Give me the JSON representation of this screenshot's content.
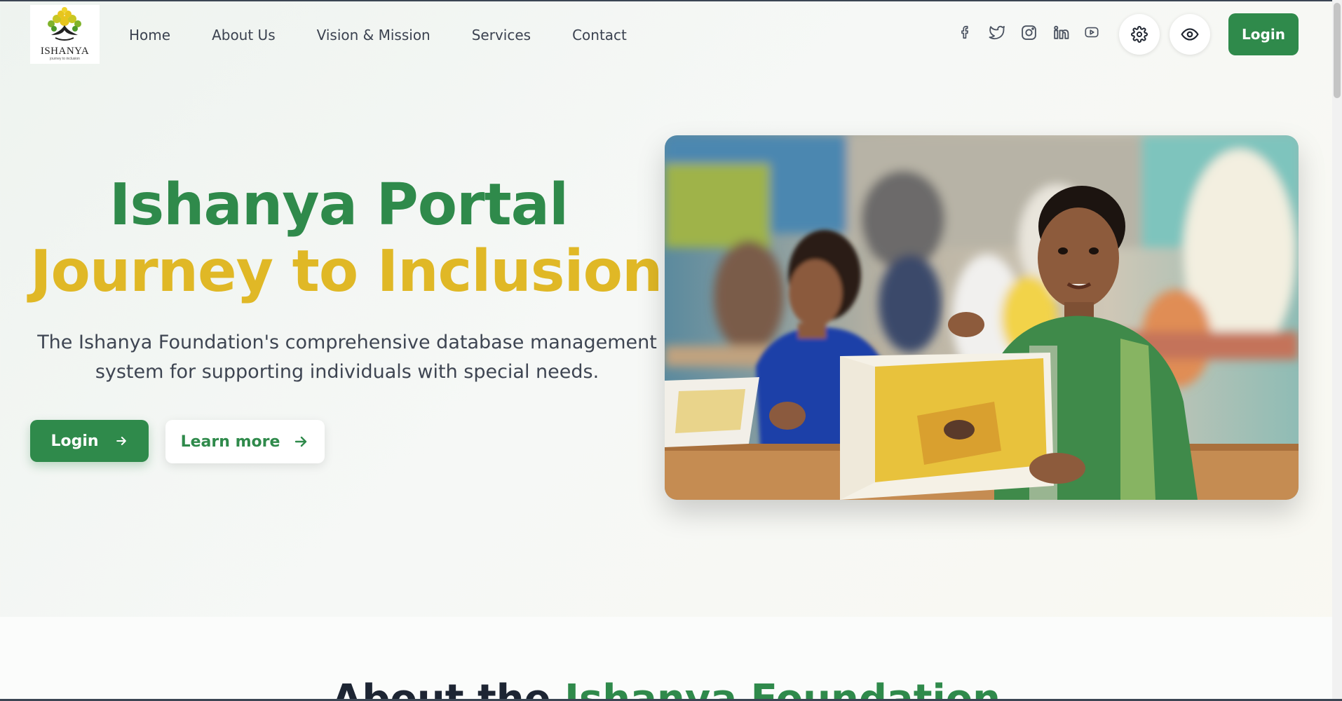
{
  "header": {
    "logo": {
      "name": "ISHANYA",
      "tagline": "journey to inclusion"
    },
    "nav": [
      {
        "label": "Home"
      },
      {
        "label": "About Us"
      },
      {
        "label": "Vision & Mission"
      },
      {
        "label": "Services"
      },
      {
        "label": "Contact"
      }
    ],
    "socials": [
      "facebook-icon",
      "twitter-icon",
      "instagram-icon",
      "linkedin-icon",
      "youtube-icon"
    ],
    "login_label": "Login"
  },
  "hero": {
    "title_line1": "Ishanya Portal",
    "title_line2": "Journey to Inclusion",
    "description": "The Ishanya Foundation's comprehensive database management system for supporting individuals with special needs.",
    "login_label": "Login",
    "learn_more_label": "Learn more"
  },
  "next_section": {
    "title_dark": "About the",
    "title_green": "Ishanya Foundation"
  },
  "colors": {
    "brand_green": "#2f8a4b",
    "brand_yellow": "#e0b826",
    "text_dark": "#3b4250"
  }
}
